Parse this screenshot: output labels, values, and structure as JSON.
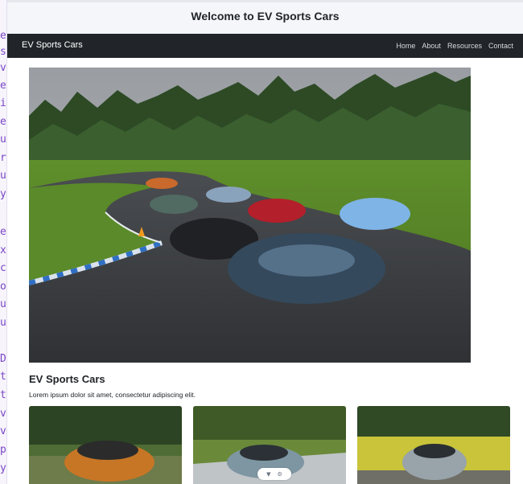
{
  "left_strip": {
    "chars": [
      "e",
      "s",
      "v",
      "e",
      "i",
      "e",
      "u",
      "r",
      "u",
      "y",
      "",
      "e",
      "x",
      "c",
      "o",
      "u",
      "u",
      "",
      "D",
      "t",
      "t",
      "v",
      "v",
      "p",
      "y"
    ]
  },
  "title_bar": {
    "title": "Welcome to EV Sports Cars"
  },
  "navbar": {
    "brand": "EV Sports Cars",
    "links": [
      "Home",
      "About",
      "Resources",
      "Contact"
    ]
  },
  "hero": {
    "image_alt": "EV sports cars on a race track"
  },
  "section": {
    "title": "EV Sports Cars",
    "text": "Lorem ipsum dolor sit amet, consectetur adipiscing elit."
  },
  "cards": [
    {
      "image_alt": "Orange electric SUV"
    },
    {
      "image_alt": "Silver electric sedan"
    },
    {
      "image_alt": "Silver electric SUV"
    }
  ],
  "carousel_controls": {
    "prev_icon": "triangle-down",
    "next_icon": "gear"
  },
  "colors": {
    "navbar_bg": "#212529",
    "title_bar_bg": "#f4f6f9",
    "left_strip_text": "#7a45c8"
  }
}
